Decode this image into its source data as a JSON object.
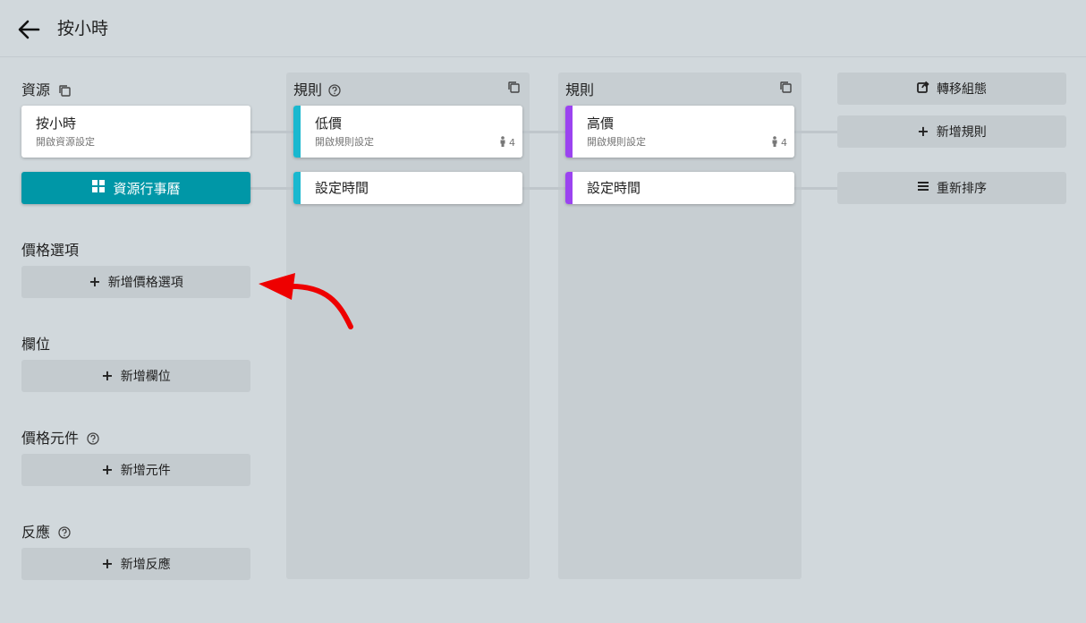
{
  "header": {
    "title": "按小時"
  },
  "resource": {
    "title": "資源",
    "card_title": "按小時",
    "card_subtitle": "開啟資源設定",
    "calendar_button": "資源行事曆"
  },
  "sections": {
    "price_options": {
      "title": "價格選項",
      "button": "新增價格選項"
    },
    "fields": {
      "title": "欄位",
      "button": "新增欄位"
    },
    "price_elements": {
      "title": "價格元件",
      "button": "新增元件"
    },
    "reactions": {
      "title": "反應",
      "button": "新增反應"
    }
  },
  "rule_columns": [
    {
      "title": "規則",
      "rule": {
        "title": "低價",
        "subtitle": "開啟規則設定",
        "count": "4",
        "color": "#1ab8cf"
      },
      "time": {
        "title": "設定時間",
        "color": "#1ab8cf"
      }
    },
    {
      "title": "規則",
      "rule": {
        "title": "高價",
        "subtitle": "開啟規則設定",
        "count": "4",
        "color": "#9b43f0"
      },
      "time": {
        "title": "設定時間",
        "color": "#9b43f0"
      }
    }
  ],
  "actions": {
    "transfer": "轉移組態",
    "add_rule": "新增規則",
    "reorder": "重新排序"
  },
  "annotation": {
    "color": "#ee0000"
  }
}
